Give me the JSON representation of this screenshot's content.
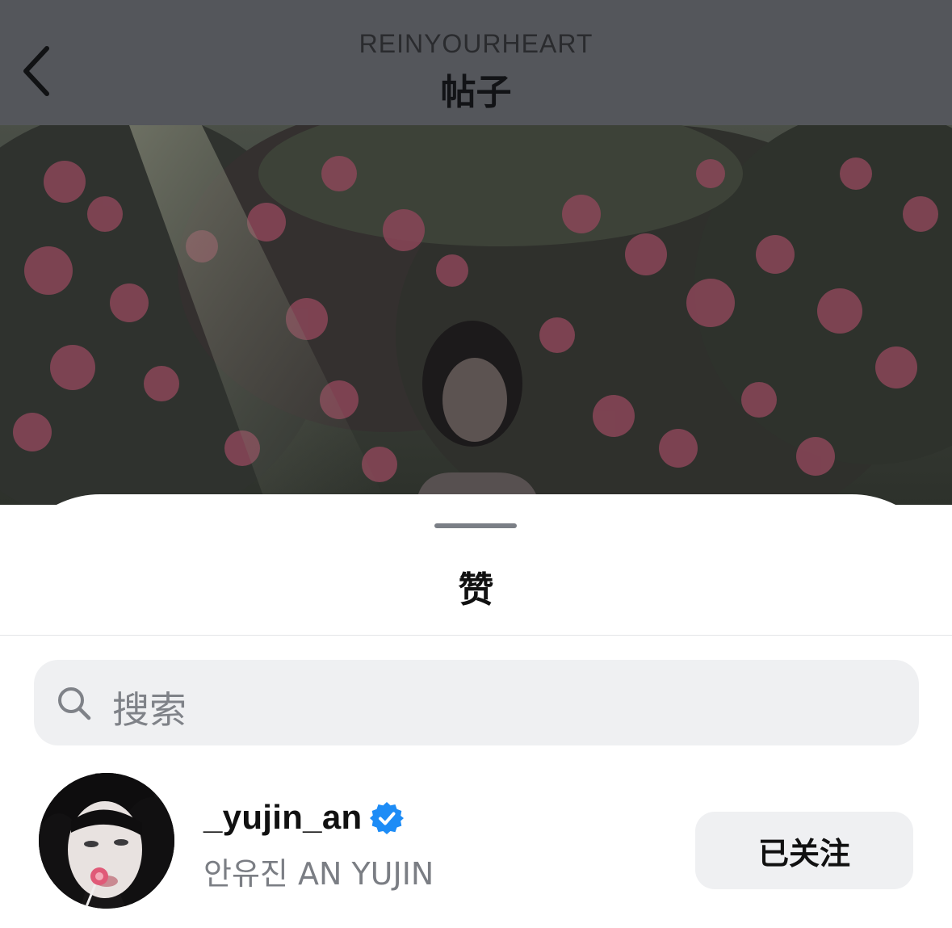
{
  "topbar": {
    "username": "REINYOURHEART",
    "title": "帖子",
    "back_icon": "chevron-left-icon"
  },
  "sheet": {
    "title": "赞",
    "search": {
      "placeholder": "搜索",
      "icon": "search-icon"
    },
    "users": [
      {
        "username": "_yujin_an",
        "verified": true,
        "full_name": "안유진 AN YUJIN",
        "follow_label": "已关注"
      }
    ]
  },
  "colors": {
    "dim_overlay": "#54565b",
    "verified_badge": "#1d8cf6",
    "search_bg": "#eff0f2",
    "button_bg": "#eff0f2",
    "secondary_text": "#7b7e84"
  }
}
